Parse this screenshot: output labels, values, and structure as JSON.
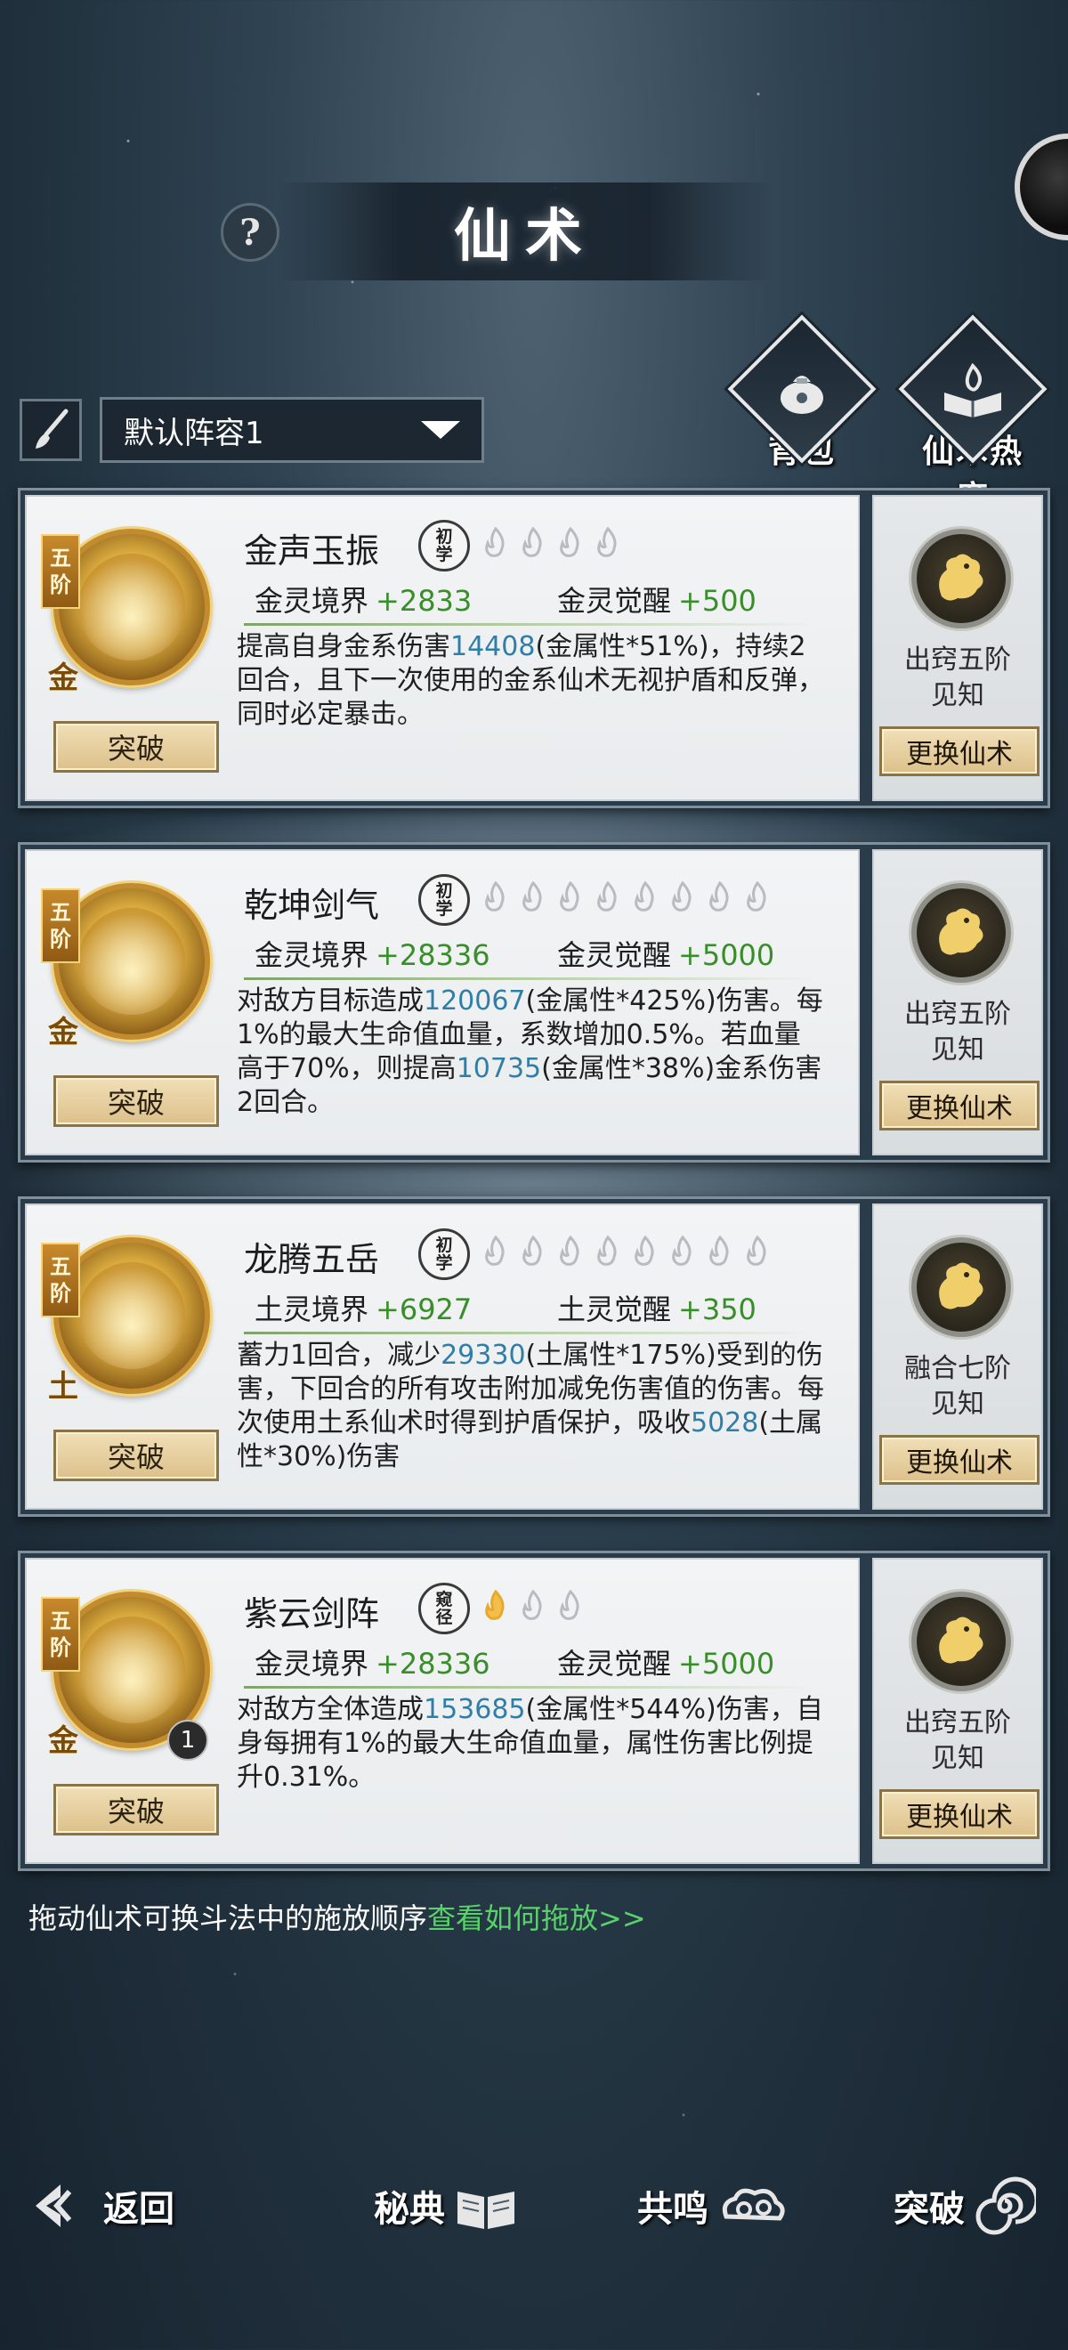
{
  "header": {
    "title": "仙术",
    "help_label": "?"
  },
  "top_buttons": [
    {
      "label": "背包",
      "icon": "bag-icon"
    },
    {
      "label": "仙术热度",
      "icon": "book-flame-icon"
    }
  ],
  "lineup": {
    "selected": "默认阵容1"
  },
  "cards": [
    {
      "tier": "五阶",
      "element": "金",
      "name": "金声玉振",
      "rank": "初学",
      "flames_total": 4,
      "flames_lit": 0,
      "stat1_label": "金灵境界",
      "stat1_value": "+2833",
      "stat2_label": "金灵觉醒",
      "stat2_value": "+500",
      "desc": [
        {
          "t": "提高自身金系伤害"
        },
        {
          "t": "14408",
          "num": true
        },
        {
          "t": "(金属性*51%)，持续2回合，且下一次使用的金系仙术无视护盾和反弹，同时必定暴击。"
        }
      ],
      "breakthrough": "突破",
      "side_label_1": "出窍五阶",
      "side_label_2": "见知",
      "swap": "更换仙术"
    },
    {
      "tier": "五阶",
      "element": "金",
      "name": "乾坤剑气",
      "rank": "初学",
      "flames_total": 8,
      "flames_lit": 0,
      "stat1_label": "金灵境界",
      "stat1_value": "+28336",
      "stat2_label": "金灵觉醒",
      "stat2_value": "+5000",
      "desc": [
        {
          "t": "对敌方目标造成"
        },
        {
          "t": "120067",
          "num": true
        },
        {
          "t": "(金属性*425%)伤害。每1%的最大生命值血量，系数增加0.5%。若血量高于70%，则提高"
        },
        {
          "t": "10735",
          "num": true
        },
        {
          "t": "(金属性*38%)金系伤害2回合。"
        }
      ],
      "breakthrough": "突破",
      "side_label_1": "出窍五阶",
      "side_label_2": "见知",
      "swap": "更换仙术"
    },
    {
      "tier": "五阶",
      "element": "土",
      "name": "龙腾五岳",
      "rank": "初学",
      "flames_total": 8,
      "flames_lit": 0,
      "stat1_label": "土灵境界",
      "stat1_value": "+6927",
      "stat2_label": "土灵觉醒",
      "stat2_value": "+350",
      "desc": [
        {
          "t": "蓄力1回合，减少"
        },
        {
          "t": "29330",
          "num": true
        },
        {
          "t": "(土属性*175%)受到的伤害，下回合的所有攻击附加减免伤害值的伤害。每次使用土系仙术时得到护盾保护，吸收"
        },
        {
          "t": "5028",
          "num": true
        },
        {
          "t": "(土属性*30%)伤害"
        }
      ],
      "breakthrough": "突破",
      "side_label_1": "融合七阶",
      "side_label_2": "见知",
      "swap": "更换仙术"
    },
    {
      "tier": "五阶",
      "element": "金",
      "name": "紫云剑阵",
      "rank": "窥径",
      "flames_total": 3,
      "flames_lit": 1,
      "badge": "1",
      "stat1_label": "金灵境界",
      "stat1_value": "+28336",
      "stat2_label": "金灵觉醒",
      "stat2_value": "+5000",
      "desc": [
        {
          "t": "对敌方全体造成"
        },
        {
          "t": "153685",
          "num": true
        },
        {
          "t": "(金属性*544%)伤害，自身每拥有1%的最大生命值血量，属性伤害比例提升0.31%。"
        }
      ],
      "breakthrough": "突破",
      "side_label_1": "出窍五阶",
      "side_label_2": "见知",
      "swap": "更换仙术"
    }
  ],
  "hint": {
    "text": "拖动仙术可换斗法中的施放顺序",
    "link": "查看如何拖放>>"
  },
  "bottom_nav": [
    {
      "label": "返回",
      "icon": "back-arrow-icon"
    },
    {
      "label": "秘典",
      "icon": "open-book-icon"
    },
    {
      "label": "共鸣",
      "icon": "cloud-swirl-icon"
    },
    {
      "label": "突破",
      "icon": "spiral-icon"
    }
  ],
  "colors": {
    "positive": "#3a8d2b",
    "number": "#2f7ea8",
    "link": "#58d36a",
    "gold": "#c28b2e"
  }
}
